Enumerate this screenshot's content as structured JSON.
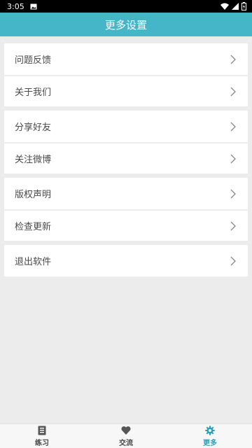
{
  "status_bar": {
    "time": "3:05"
  },
  "header": {
    "title": "更多设置"
  },
  "menu": {
    "groups": [
      {
        "items": [
          {
            "label": "问题反馈"
          },
          {
            "label": "关于我们"
          }
        ]
      },
      {
        "items": [
          {
            "label": "分享好友"
          },
          {
            "label": "关注微博"
          }
        ]
      },
      {
        "items": [
          {
            "label": "版权声明"
          },
          {
            "label": "检查更新"
          }
        ]
      },
      {
        "items": [
          {
            "label": "退出软件"
          }
        ]
      }
    ]
  },
  "tabbar": {
    "tabs": [
      {
        "label": "练习",
        "icon": "book-icon",
        "active": false
      },
      {
        "label": "交流",
        "icon": "heart-icon",
        "active": false
      },
      {
        "label": "更多",
        "icon": "gear-icon",
        "active": true
      }
    ]
  },
  "colors": {
    "accent": "#45b6c8",
    "active_tab": "#2aa3b8",
    "background": "#ececec"
  }
}
